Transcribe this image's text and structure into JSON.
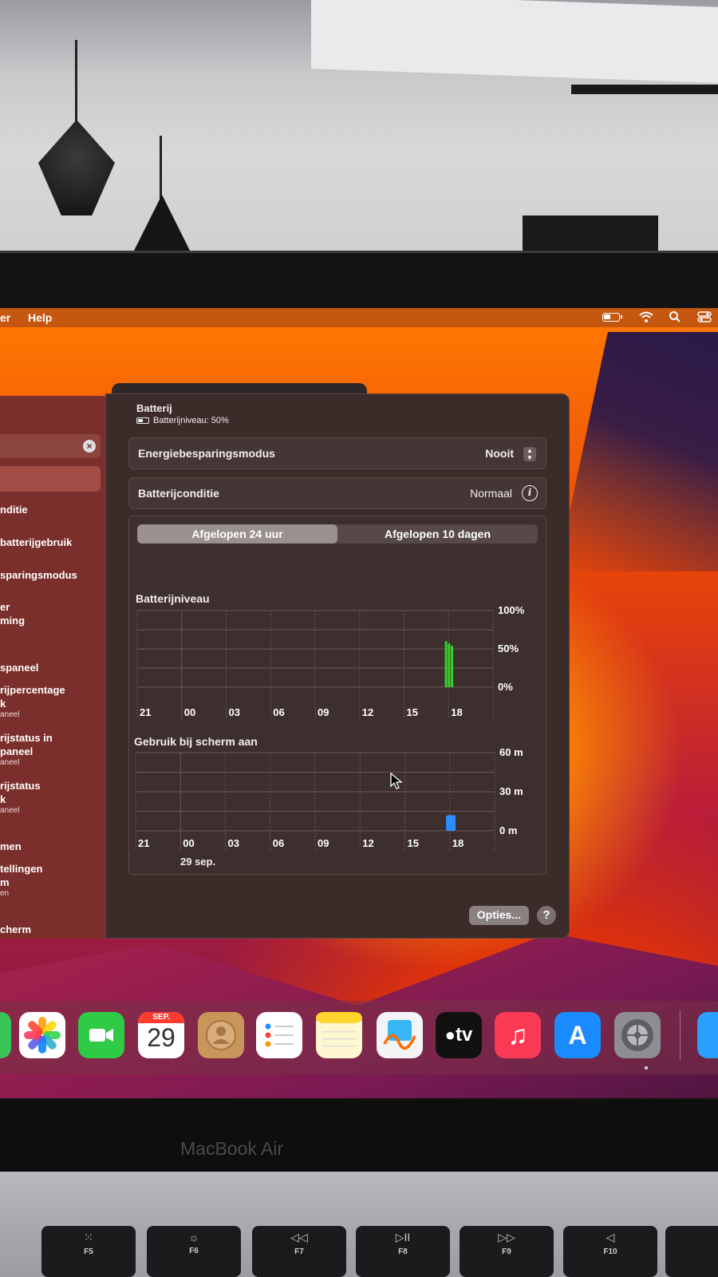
{
  "menubar": {
    "items": [
      "er",
      "Help"
    ]
  },
  "window": {
    "title": "Batterij",
    "subtitle": "Batterijniveau: 50%",
    "rows": [
      {
        "label": "Energiebesparingsmodus",
        "value": "Nooit"
      },
      {
        "label": "Batterijconditie",
        "value": "Normaal"
      }
    ],
    "tabs": [
      "Afgelopen 24 uur",
      "Afgelopen 10 dagen"
    ],
    "active_tab": "Afgelopen 24 uur",
    "options_label": "Opties...",
    "help_label": "?"
  },
  "sidebar": {
    "clear_icon": "×",
    "items": [
      {
        "label": "nditie",
        "sub": ""
      },
      {
        "label": "batterijgebruik",
        "sub": ""
      },
      {
        "label": "sparingsmodus",
        "sub": ""
      },
      {
        "label": "er\nming",
        "sub": ""
      },
      {
        "label": "spaneel",
        "sub": ""
      },
      {
        "label": "rijpercentage\nk",
        "sub": "aneel"
      },
      {
        "label": "rijstatus in\npaneel",
        "sub": "aneel"
      },
      {
        "label": "rijstatus\nk",
        "sub": "aneel"
      },
      {
        "label": "men",
        "sub": ""
      },
      {
        "label": "tellingen\nm",
        "sub": "en"
      },
      {
        "label": "cherm",
        "sub": ""
      }
    ]
  },
  "chart_data": [
    {
      "type": "bar",
      "title": "Batterijniveau",
      "x_tick_labels": [
        "21",
        "00",
        "03",
        "06",
        "09",
        "12",
        "15",
        "18"
      ],
      "y_tick_labels": [
        "100%",
        "50%",
        "0%"
      ],
      "ylim": [
        0,
        100
      ],
      "grid": true,
      "series": [
        {
          "color": "#33d12c",
          "x_hours_after_start": [
            20.75,
            20.95,
            21.15
          ],
          "values": [
            60,
            57,
            54
          ]
        }
      ]
    },
    {
      "type": "bar",
      "title": "Gebruik bij scherm aan",
      "x_tick_labels": [
        "21",
        "00",
        "03",
        "06",
        "09",
        "12",
        "15",
        "18"
      ],
      "y_tick_labels": [
        "60 m",
        "30 m",
        "0 m"
      ],
      "ylim": [
        0,
        60
      ],
      "grid": true,
      "date_label": "29 sep.",
      "series": [
        {
          "color": "#2a8cff",
          "x_hours_after_start": [
            20.75
          ],
          "values": [
            12
          ]
        }
      ]
    }
  ],
  "dock": {
    "calendar_month": "SEP.",
    "calendar_day": "29",
    "tv_label": "tv",
    "music_glyph": "♫",
    "appstore_glyph": "A"
  },
  "hardware": {
    "brand": "MacBook Air",
    "keys": [
      {
        "label": "F5",
        "symbol": "⁙"
      },
      {
        "label": "F6",
        "symbol": "☼"
      },
      {
        "label": "F7",
        "symbol": "◁◁"
      },
      {
        "label": "F8",
        "symbol": "▷II"
      },
      {
        "label": "F9",
        "symbol": "▷▷"
      },
      {
        "label": "F10",
        "symbol": "◁"
      }
    ]
  }
}
